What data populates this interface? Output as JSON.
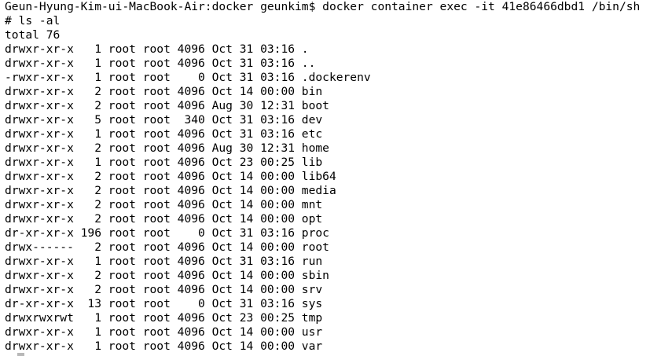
{
  "terminal": {
    "lines": [
      "Geun-Hyung-Kim-ui-MacBook-Air:docker geunkim$ docker container exec -it 41e86466dbd1 /bin/sh",
      "# ls -al",
      "total 76",
      "drwxr-xr-x   1 root root 4096 Oct 31 03:16 .",
      "drwxr-xr-x   1 root root 4096 Oct 31 03:16 ..",
      "-rwxr-xr-x   1 root root    0 Oct 31 03:16 .dockerenv",
      "drwxr-xr-x   2 root root 4096 Oct 14 00:00 bin",
      "drwxr-xr-x   2 root root 4096 Aug 30 12:31 boot",
      "drwxr-xr-x   5 root root  340 Oct 31 03:16 dev",
      "drwxr-xr-x   1 root root 4096 Oct 31 03:16 etc",
      "drwxr-xr-x   2 root root 4096 Aug 30 12:31 home",
      "drwxr-xr-x   1 root root 4096 Oct 23 00:25 lib",
      "drwxr-xr-x   2 root root 4096 Oct 14 00:00 lib64",
      "drwxr-xr-x   2 root root 4096 Oct 14 00:00 media",
      "drwxr-xr-x   2 root root 4096 Oct 14 00:00 mnt",
      "drwxr-xr-x   2 root root 4096 Oct 14 00:00 opt",
      "dr-xr-xr-x 196 root root    0 Oct 31 03:16 proc",
      "drwx------   2 root root 4096 Oct 14 00:00 root",
      "drwxr-xr-x   1 root root 4096 Oct 31 03:16 run",
      "drwxr-xr-x   2 root root 4096 Oct 14 00:00 sbin",
      "drwxr-xr-x   2 root root 4096 Oct 14 00:00 srv",
      "dr-xr-xr-x  13 root root    0 Oct 31 03:16 sys",
      "drwxrwxrwt   1 root root 4096 Oct 23 00:25 tmp",
      "drwxr-xr-x   1 root root 4096 Oct 14 00:00 usr",
      "drwxr-xr-x   1 root root 4096 Oct 14 00:00 var"
    ]
  },
  "colors": {
    "background": "#ffffff",
    "text": "#000000",
    "cursor": "#b8b8b8"
  }
}
